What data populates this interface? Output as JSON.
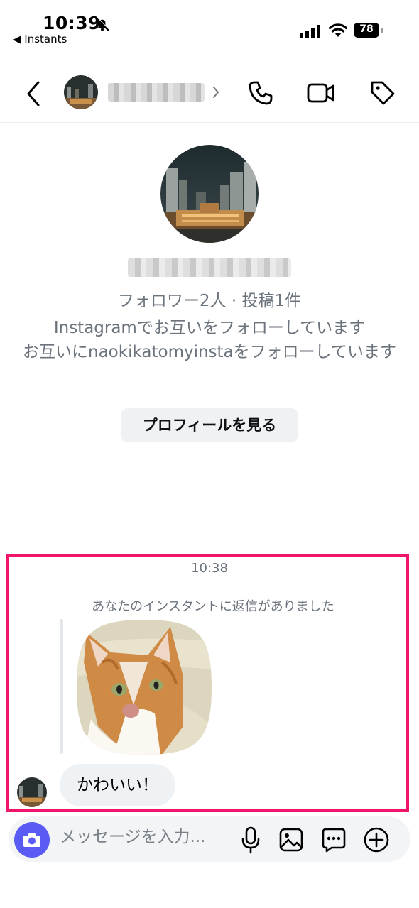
{
  "status_bar": {
    "time": "10:39",
    "back_app": "◀ Instants",
    "battery": "78"
  },
  "header": {
    "icons": [
      "back-icon",
      "chevron-right-icon",
      "phone-icon",
      "video-camera-icon",
      "tag-icon"
    ]
  },
  "profile": {
    "stats": "フォロワー2人 · 投稿1件",
    "mutual_instagram": "Instagramでお互いをフォローしています",
    "mutual_follow": "お互いにnaokikatomyinstaをフォローしています",
    "view_profile_button": "プロフィールを見る"
  },
  "conversation": {
    "timestamp": "10:38",
    "reply_note": "あなたのインスタントに返信がありました",
    "message_text": "かわいい！",
    "highlight_color": "#f0146a"
  },
  "composer": {
    "placeholder": "メッセージを入力...",
    "accent_color": "#5a5af5",
    "icons": [
      "camera-icon",
      "microphone-icon",
      "gallery-icon",
      "sticker-icon",
      "plus-icon"
    ]
  }
}
